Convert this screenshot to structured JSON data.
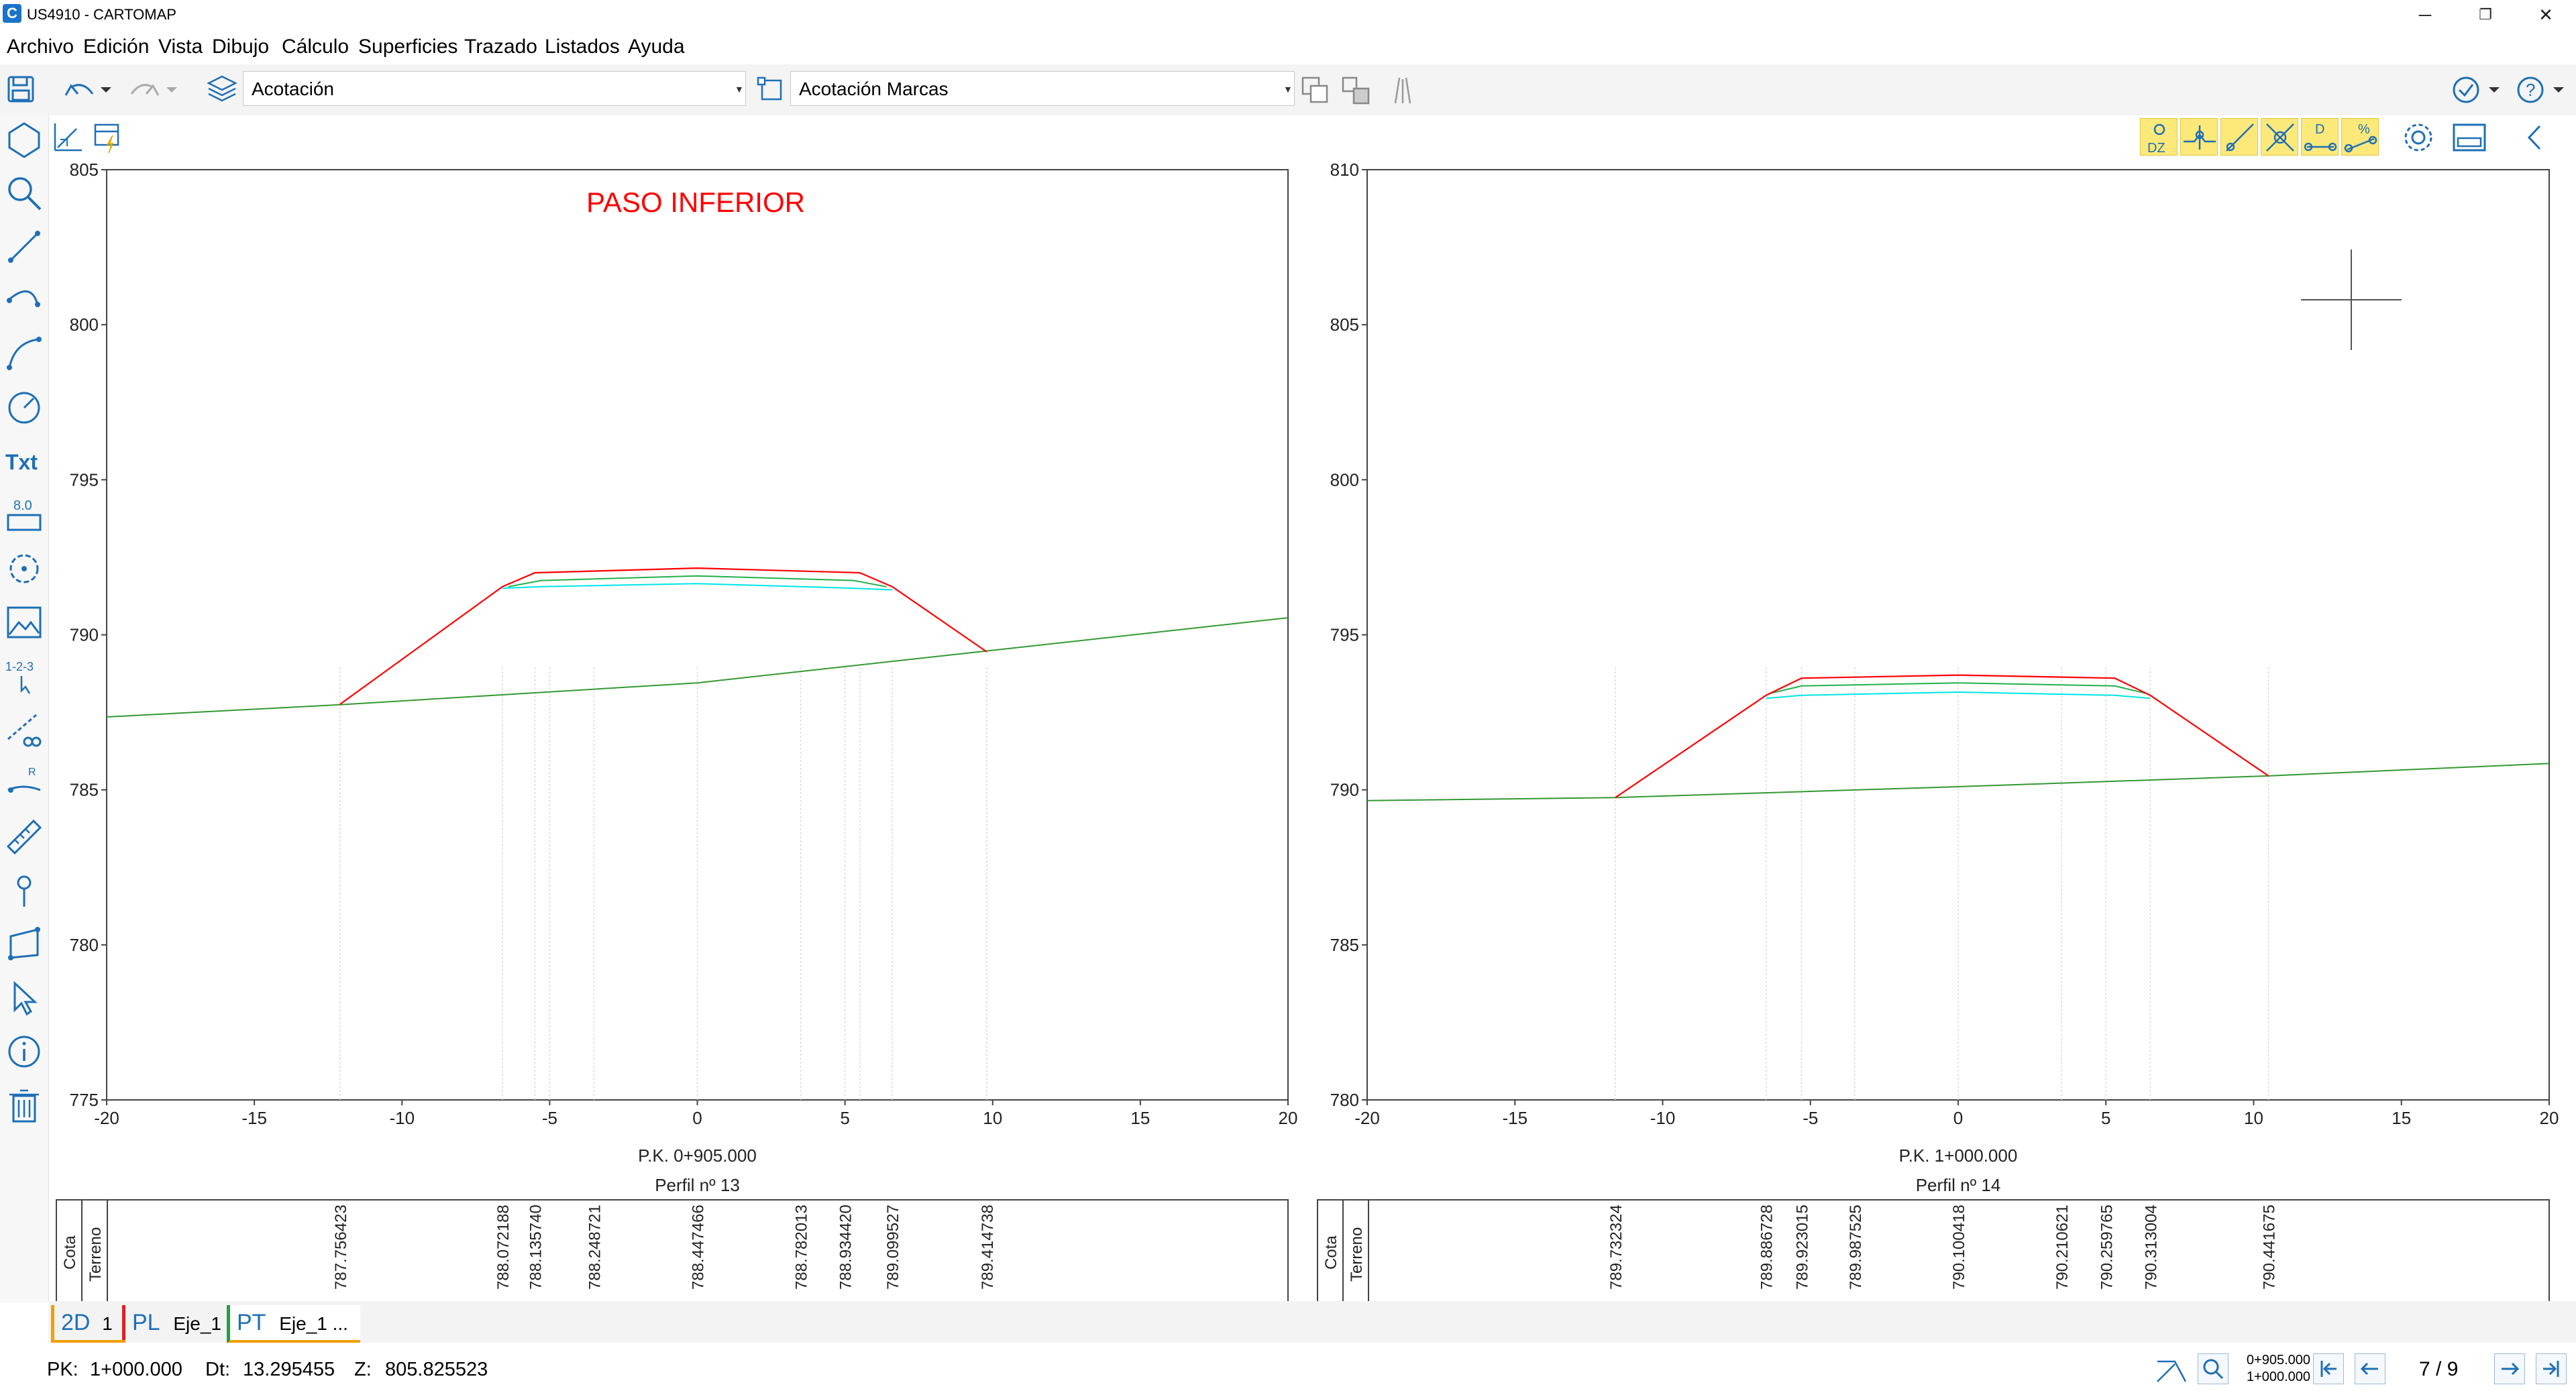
{
  "window": {
    "title": "US4910 - CARTOMAP",
    "app_icon": "C"
  },
  "window_controls": {
    "minimize": "─",
    "restore": "❐",
    "close": "✕"
  },
  "menu": [
    "Archivo",
    "Edición",
    "Vista",
    "Dibujo",
    "Cálculo",
    "Superficies",
    "Trazado",
    "Listados",
    "Ayuda"
  ],
  "toolbar": {
    "layer_combo": "Acotación",
    "style_combo": "Acotación Marcas"
  },
  "toolbar2": {
    "dz_label": "DZ",
    "d_label": "D",
    "pct_label": "%"
  },
  "left_tools": {
    "txt_label": "Txt",
    "dim_label": "8.0",
    "seq_label": "1-2-3",
    "radius_label": "R"
  },
  "annotation": {
    "text": "PASO INFERIOR",
    "color": "#ff0000"
  },
  "colors": {
    "surface": "#ff0000",
    "green": "#22b14c",
    "cyan": "#00e5e5",
    "terrain": "#339933",
    "accent": "#1e6fb5"
  },
  "profiles": [
    {
      "ylim": [
        775,
        805
      ],
      "yticks": [
        "805",
        "800",
        "795",
        "790",
        "785",
        "780",
        "775"
      ],
      "xlim": [
        -20,
        20
      ],
      "xticks": [
        "-20",
        "-15",
        "-10",
        "-5",
        "0",
        "5",
        "10",
        "15",
        "20"
      ],
      "pk_label": "P.K. 0+905.000",
      "profile_label": "Perfil nº 13",
      "row_labels": [
        "Cota",
        "Terreno"
      ],
      "terrain_points": [
        [
          -20,
          787.35
        ],
        [
          -12,
          787.75
        ],
        [
          0,
          788.45
        ],
        [
          10,
          789.5
        ],
        [
          20,
          790.55
        ]
      ],
      "section_points": [
        [
          -12.1,
          787.76
        ],
        [
          -6.6,
          791.55
        ],
        [
          -5.5,
          792.0
        ],
        [
          0,
          792.15
        ],
        [
          5.5,
          792.0
        ],
        [
          6.6,
          791.55
        ],
        [
          9.8,
          789.45
        ]
      ],
      "layer2_points": [
        [
          -6.4,
          791.55
        ],
        [
          -5.3,
          791.75
        ],
        [
          0,
          791.9
        ],
        [
          5.3,
          791.75
        ],
        [
          6.4,
          791.55
        ]
      ],
      "layer3_points": [
        [
          -6.6,
          791.5
        ],
        [
          -5.3,
          791.55
        ],
        [
          0,
          791.65
        ],
        [
          5.3,
          791.5
        ],
        [
          6.6,
          791.45
        ]
      ],
      "vertical_x": [
        -12.1,
        -6.6,
        -5.5,
        -5.0,
        -3.5,
        0,
        3.5,
        5.0,
        5.5,
        6.6,
        9.8
      ],
      "terreno_values": [
        {
          "x": -12.1,
          "v": "787.756423"
        },
        {
          "x": -6.6,
          "v": "788.072188"
        },
        {
          "x": -5.5,
          "v": "788.135740"
        },
        {
          "x": -3.5,
          "v": "788.248721"
        },
        {
          "x": 0,
          "v": "788.447466"
        },
        {
          "x": 3.5,
          "v": "788.782013"
        },
        {
          "x": 5.0,
          "v": "788.934420"
        },
        {
          "x": 6.6,
          "v": "789.099527"
        },
        {
          "x": 9.8,
          "v": "789.414738"
        }
      ]
    },
    {
      "ylim": [
        780,
        810
      ],
      "yticks": [
        "810",
        "805",
        "800",
        "795",
        "790",
        "785",
        "780"
      ],
      "xlim": [
        -20,
        20
      ],
      "xticks": [
        "-20",
        "-15",
        "-10",
        "-5",
        "0",
        "5",
        "10",
        "15",
        "20"
      ],
      "pk_label": "P.K. 1+000.000",
      "profile_label": "Perfil nº 14",
      "row_labels": [
        "Cota",
        "Terreno"
      ],
      "terrain_points": [
        [
          -20,
          789.65
        ],
        [
          -11.6,
          789.75
        ],
        [
          0,
          790.1
        ],
        [
          10.5,
          790.45
        ],
        [
          20,
          790.85
        ]
      ],
      "section_points": [
        [
          -11.6,
          789.75
        ],
        [
          -6.5,
          793.05
        ],
        [
          -5.3,
          793.6
        ],
        [
          0,
          793.7
        ],
        [
          5.3,
          793.6
        ],
        [
          6.5,
          793.05
        ],
        [
          10.5,
          790.45
        ]
      ],
      "layer2_points": [
        [
          -6.4,
          793.1
        ],
        [
          -5.3,
          793.35
        ],
        [
          0,
          793.45
        ],
        [
          5.3,
          793.35
        ],
        [
          6.4,
          793.1
        ]
      ],
      "layer3_points": [
        [
          -6.5,
          792.95
        ],
        [
          -5.3,
          793.05
        ],
        [
          0,
          793.15
        ],
        [
          5.3,
          793.05
        ],
        [
          6.5,
          792.95
        ]
      ],
      "vertical_x": [
        -11.6,
        -6.5,
        -5.3,
        -3.5,
        0,
        3.5,
        5.0,
        6.5,
        10.5
      ],
      "terreno_values": [
        {
          "x": -11.6,
          "v": "789.732324"
        },
        {
          "x": -6.5,
          "v": "789.886728"
        },
        {
          "x": -5.3,
          "v": "789.923015"
        },
        {
          "x": -3.5,
          "v": "789.987525"
        },
        {
          "x": 0,
          "v": "790.100418"
        },
        {
          "x": 3.5,
          "v": "790.210621"
        },
        {
          "x": 5.0,
          "v": "790.259765"
        },
        {
          "x": 6.5,
          "v": "790.313004"
        },
        {
          "x": 10.5,
          "v": "790.441675"
        }
      ]
    }
  ],
  "chart_data": [
    {
      "type": "line",
      "title": "P.K. 0+905.000",
      "subtitle": "Perfil nº 13",
      "xlim": [
        -20,
        20
      ],
      "ylim": [
        775,
        805
      ],
      "series": [
        {
          "name": "Terreno",
          "x": [
            -12.1,
            -6.6,
            -5.5,
            -3.5,
            0,
            3.5,
            5.0,
            6.6,
            9.8
          ],
          "y": [
            787.756423,
            788.072188,
            788.13574,
            788.248721,
            788.447466,
            788.782013,
            788.93442,
            789.099527,
            789.414738
          ]
        }
      ]
    },
    {
      "type": "line",
      "title": "P.K. 1+000.000",
      "subtitle": "Perfil nº 14",
      "xlim": [
        -20,
        20
      ],
      "ylim": [
        780,
        810
      ],
      "series": [
        {
          "name": "Terreno",
          "x": [
            -11.6,
            -6.5,
            -5.3,
            -3.5,
            0,
            3.5,
            5.0,
            6.5,
            10.5
          ],
          "y": [
            789.732324,
            789.886728,
            789.923015,
            789.987525,
            790.100418,
            790.210621,
            790.259765,
            790.313004,
            790.441675
          ]
        }
      ]
    }
  ],
  "tabs": [
    {
      "prefix": "2D",
      "label": "1",
      "color": "#f0a000"
    },
    {
      "prefix": "PL",
      "label": "Eje_1",
      "color": "#e02020"
    },
    {
      "prefix": "PT",
      "label": "Eje_1 ...",
      "color": "#20a040"
    }
  ],
  "status": {
    "pk_label": "PK:",
    "pk_value": "1+000.000",
    "dt_label": "Dt:",
    "dt_value": "13.295455",
    "z_label": "Z:",
    "z_value": "805.825523",
    "range_top": "0+905.000",
    "range_bottom": "1+000.000",
    "page": "7 / 9"
  }
}
